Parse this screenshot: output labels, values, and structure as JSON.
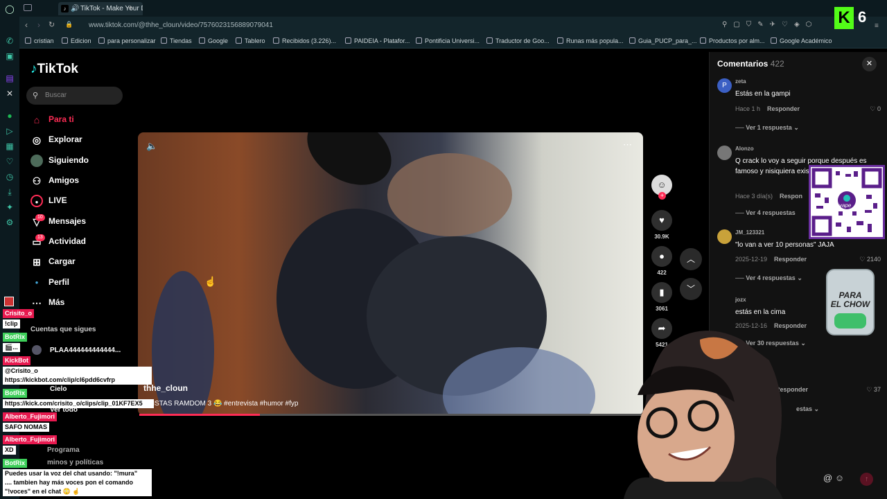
{
  "browser": {
    "tab_title": "TikTok - Make Your Da",
    "url": "www.tiktok.com/@thhe_cloun/video/7576023156889079041",
    "bookmarks": [
      "cristian",
      "Edicion",
      "para personalizar",
      "Tiendas",
      "Google",
      "Tablero",
      "Recibidos (3.226)...",
      "PAIDEIA - Platafor...",
      "Pontificia Universi...",
      "Traductor de Goo...",
      "Runas más popula...",
      "Guia_PUCP_para_...",
      "Productos por alm...",
      "Google Académico"
    ]
  },
  "tiktok": {
    "logo": "TikTok",
    "search_placeholder": "Buscar",
    "nav": [
      {
        "label": "Para ti",
        "icon": "home-icon"
      },
      {
        "label": "Explorar",
        "icon": "compass-icon"
      },
      {
        "label": "Siguiendo",
        "icon": "avatar-icon"
      },
      {
        "label": "Amigos",
        "icon": "friends-icon"
      },
      {
        "label": "LIVE",
        "icon": "live-icon"
      },
      {
        "label": "Mensajes",
        "icon": "send-icon",
        "badge": "10"
      },
      {
        "label": "Actividad",
        "icon": "inbox-icon",
        "badge": "13"
      },
      {
        "label": "Cargar",
        "icon": "plus-square-icon"
      },
      {
        "label": "Perfil",
        "icon": "profile-icon"
      },
      {
        "label": "Más",
        "icon": "more-icon"
      }
    ],
    "following_header": "Cuentas que sigues",
    "following": [
      "PLAA444444444444...",
      "Cielo"
    ],
    "see_all": "Ver todo",
    "footer_a": "Programa",
    "footer_b": "minos y políticas"
  },
  "video": {
    "author": "thhe_cloun",
    "caption": "EVISTAS RAMDOM 3 😂 #entrevista #humor #fyp",
    "progress": 0.24
  },
  "actions": {
    "likes": "30.9K",
    "comments": "422",
    "saves": "3061",
    "shares": "5421"
  },
  "comments": {
    "title": "Comentarios",
    "count": "422",
    "items": [
      {
        "user": "zeta",
        "text": "Estás en la gampi",
        "date": "Hace 1 h",
        "reply": "Responder",
        "likes": "0",
        "more": "Ver 1 respuesta"
      },
      {
        "user": "Alonzo",
        "text": "Q crack lo voy a seguir porque después es famoso y nisiquiera existencia",
        "date": "Hace 3 día(s)",
        "reply": "Respon",
        "likes": "",
        "more": "Ver 4 respuestas"
      },
      {
        "user": "JM_123321",
        "text": "\"lo van a ver 10 personas\" JAJA",
        "date": "2025-12-19",
        "reply": "Responder",
        "likes": "2140",
        "more": "Ver 4 respuestas"
      },
      {
        "user": "jozx",
        "text": "estás en la cima",
        "date": "2025-12-16",
        "reply": "Responder",
        "likes": "",
        "more": "Ver 30 respuestas"
      },
      {
        "user": "",
        "text": "uturo",
        "date": "",
        "reply": "Responder",
        "likes": "37",
        "more": "estas"
      }
    ]
  },
  "overlay": {
    "kick_count": "6",
    "jar_text_a": "PARA",
    "jar_text_b": "EL CHOW",
    "qr_label": "yape",
    "chat": [
      {
        "type": "user",
        "text": "Crisito_o",
        "color": "#e8194f"
      },
      {
        "type": "msg",
        "text": "!clip"
      },
      {
        "type": "user",
        "text": "BotRix",
        "color": "#3ecf5a"
      },
      {
        "type": "msg",
        "text": "🎬..."
      },
      {
        "type": "user",
        "text": "KickBot",
        "color": "#e8194f"
      },
      {
        "type": "msg",
        "text": "@Crisito_o"
      },
      {
        "type": "msg",
        "text": "https://kickbot.com/clip/cl6pdd6cvfrp"
      },
      {
        "type": "user",
        "text": "BotRix",
        "color": "#3ecf5a"
      },
      {
        "type": "msg",
        "text": "https://kick.com/crisito_o/clips/clip_01KF7EX5"
      },
      {
        "type": "user",
        "text": "Alberto_Fujimori",
        "color": "#e8194f"
      },
      {
        "type": "msg",
        "text": "SAFO NOMAS"
      },
      {
        "type": "user",
        "text": "Alberto_Fujimori",
        "color": "#e8194f"
      },
      {
        "type": "msg",
        "text": "XD"
      },
      {
        "type": "user",
        "text": "BotRix",
        "color": "#3ecf5a"
      },
      {
        "type": "msg",
        "text": "Puedes usar la voz del chat usando: \"!mura\""
      },
      {
        "type": "msg",
        "text": ".... tambien hay más voces pon el comando"
      },
      {
        "type": "msg",
        "text": "\"!voces\" en el chat 😳 ☝"
      }
    ]
  }
}
